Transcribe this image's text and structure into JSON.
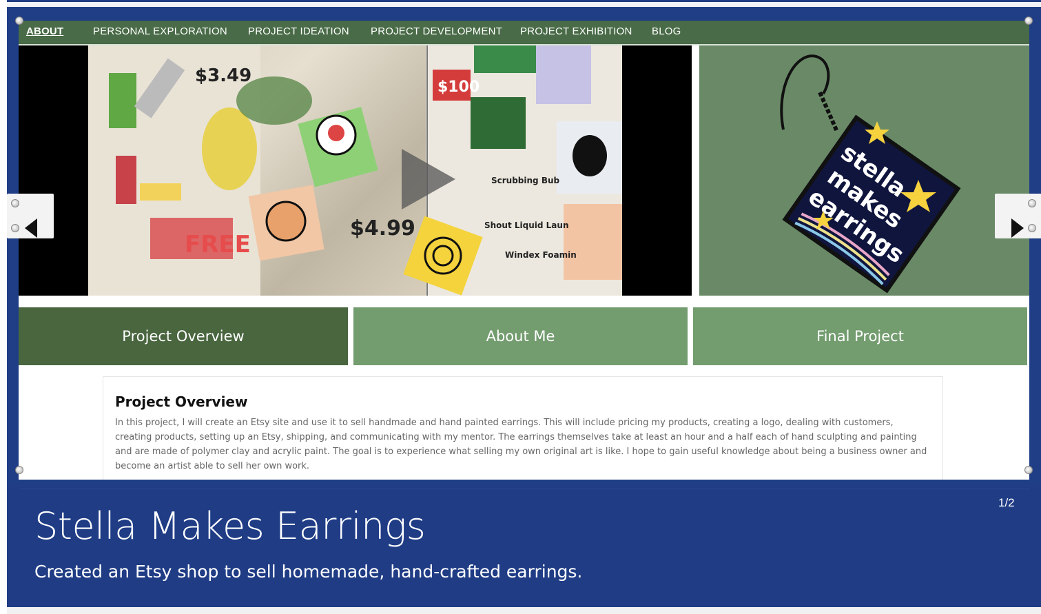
{
  "nav": {
    "items": [
      {
        "label": "ABOUT",
        "active": true
      },
      {
        "label": "PERSONAL EXPLORATION",
        "active": false
      },
      {
        "label": "PROJECT IDEATION",
        "active": false
      },
      {
        "label": "PROJECT DEVELOPMENT",
        "active": false
      },
      {
        "label": "PROJECT EXHIBITION",
        "active": false
      },
      {
        "label": "BLOG",
        "active": false
      }
    ]
  },
  "logo": {
    "text_lines": [
      "stella",
      "makes",
      "earrings"
    ]
  },
  "tabs": [
    {
      "label": "Project Overview",
      "active": true
    },
    {
      "label": "About Me",
      "active": false
    },
    {
      "label": "Final Project",
      "active": false
    }
  ],
  "overview": {
    "title": "Project Overview",
    "body": "In this project, I will create an Etsy site and use it to sell handmade and hand painted earrings. This will include pricing my products, creating a logo, dealing with customers, creating products, setting up an Etsy, shipping, and communicating with my mentor. The earrings themselves take at least an hour and a half each of hand sculpting and painting and are made of polymer clay and acrylic paint. The goal is to experience what selling my own original art is like. I hope to gain useful knowledge about being a business owner and become an artist able to sell her own work."
  },
  "caption": {
    "title": "Stella Makes Earrings",
    "subtitle": "Created an Etsy shop to sell homemade, hand-crafted earrings.",
    "counter": "1/2"
  },
  "colors": {
    "nav_bg": "#496b47",
    "tab_active": "#49663f",
    "tab_inactive": "#739c6f",
    "logo_bg": "#6a8a67",
    "caption_bg": "#1f3c85"
  },
  "icons": {
    "prev": "chevron-left-icon",
    "next": "chevron-right-icon",
    "play": "play-icon"
  }
}
